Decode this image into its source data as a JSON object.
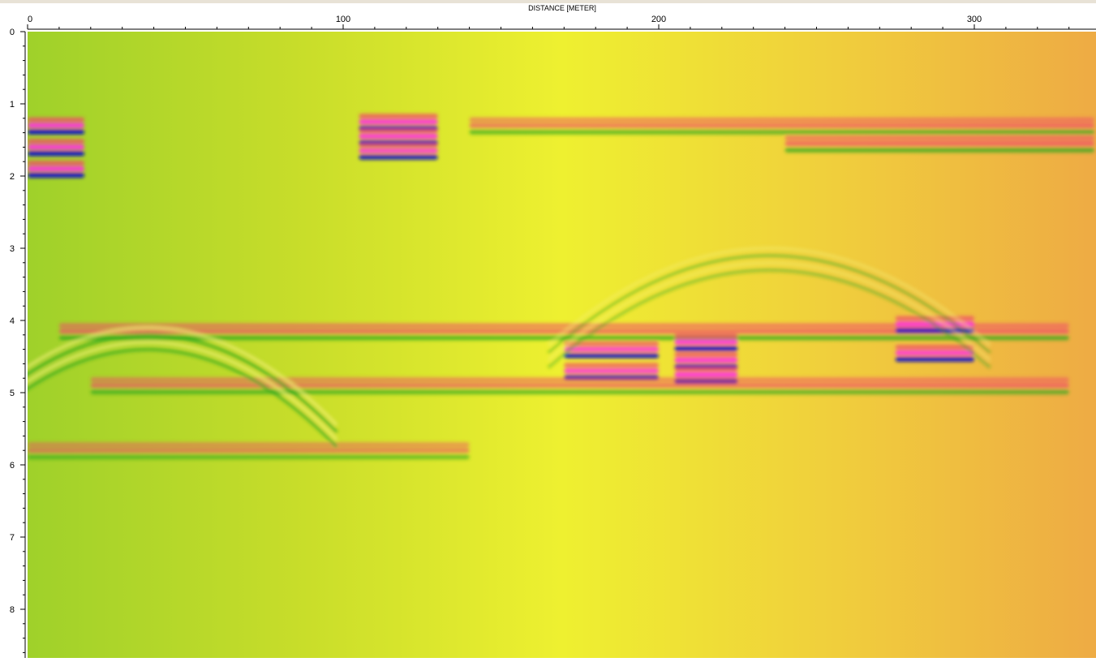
{
  "chart_data": {
    "type": "heatmap",
    "title": "",
    "xlabel": "DISTANCE [METER]",
    "ylabel": "",
    "xlim": [
      0,
      338
    ],
    "ylim": [
      0,
      8.7
    ],
    "x_ticks": [
      0,
      100,
      200,
      300
    ],
    "y_ticks": [
      0,
      1,
      2,
      3,
      4,
      5,
      6,
      7,
      8
    ],
    "x_minor_step": 10,
    "y_minor_step": 0.2,
    "grid": false,
    "legend": "none",
    "colors": {
      "background_gradient": [
        "#9fd12a",
        "#c7dd2a",
        "#eef030",
        "#f0cf3c",
        "#eeab44"
      ],
      "positive_peak": "#f04a6a",
      "positive_max": "#ff30e0",
      "negative_peak": "#2aa61e",
      "negative_max": "#1010c8",
      "frame": "#e8e2d6"
    },
    "reflectors": [
      {
        "x": [
          0,
          18
        ],
        "depth": 1.3,
        "strength": 1.0
      },
      {
        "x": [
          0,
          18
        ],
        "depth": 1.6,
        "strength": 1.0
      },
      {
        "x": [
          0,
          18
        ],
        "depth": 1.9,
        "strength": 1.0
      },
      {
        "x": [
          105,
          130
        ],
        "depth": 1.25,
        "strength": 1.0
      },
      {
        "x": [
          105,
          130
        ],
        "depth": 1.45,
        "strength": 1.0
      },
      {
        "x": [
          105,
          130
        ],
        "depth": 1.65,
        "strength": 0.9
      },
      {
        "x": [
          140,
          338
        ],
        "depth": 1.3,
        "strength": 0.5
      },
      {
        "x": [
          240,
          338
        ],
        "depth": 1.55,
        "strength": 0.6
      },
      {
        "x": [
          10,
          330
        ],
        "depth": 4.15,
        "strength": 0.6
      },
      {
        "x": [
          170,
          200
        ],
        "depth": 4.4,
        "strength": 0.9
      },
      {
        "x": [
          170,
          200
        ],
        "depth": 4.7,
        "strength": 0.9
      },
      {
        "x": [
          205,
          225
        ],
        "depth": 4.3,
        "strength": 1.0
      },
      {
        "x": [
          205,
          225
        ],
        "depth": 4.55,
        "strength": 1.0
      },
      {
        "x": [
          205,
          225
        ],
        "depth": 4.75,
        "strength": 1.0
      },
      {
        "x": [
          275,
          300
        ],
        "depth": 4.05,
        "strength": 0.9
      },
      {
        "x": [
          275,
          300
        ],
        "depth": 4.45,
        "strength": 0.9
      },
      {
        "x": [
          20,
          330
        ],
        "depth": 4.9,
        "strength": 0.5
      },
      {
        "x": [
          0,
          140
        ],
        "depth": 5.8,
        "strength": 0.4
      }
    ],
    "diffraction_hyperbolas": [
      {
        "apex_x": 38,
        "apex_depth": 4.1,
        "width": 60,
        "strength": 0.8
      },
      {
        "apex_x": 235,
        "apex_depth": 3.0,
        "width": 70,
        "strength": 0.3
      }
    ]
  }
}
